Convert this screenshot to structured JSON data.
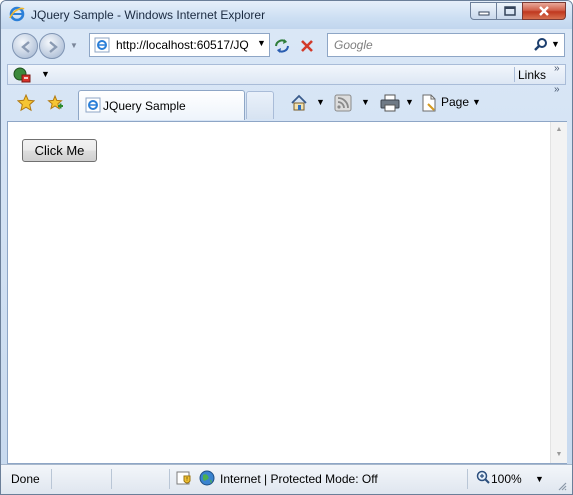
{
  "window": {
    "title": "JQuery Sample - Windows Internet Explorer"
  },
  "address": {
    "url": "http://localhost:60517/JQ"
  },
  "search": {
    "placeholder": "Google"
  },
  "links_bar": {
    "label": "Links"
  },
  "tabs": [
    {
      "label": "JQuery Sample"
    }
  ],
  "commands": {
    "page_label": "Page"
  },
  "content": {
    "button_label": "Click Me"
  },
  "status": {
    "left_text": "Done",
    "zone_text": "Internet | Protected Mode: Off",
    "zoom": "100%"
  },
  "colors": {
    "chrome": "#c7d9ee",
    "close_button": "#c0381f",
    "content_bg": "#ffffff"
  },
  "icons": [
    "ie-icon",
    "back-icon",
    "forward-icon",
    "refresh-icon",
    "stop-icon",
    "search-icon",
    "addon-icon",
    "favorites-star-icon",
    "add-favorite-icon",
    "home-icon",
    "feeds-icon",
    "print-icon",
    "page-icon",
    "shield-icon",
    "globe-icon",
    "zoom-icon"
  ]
}
